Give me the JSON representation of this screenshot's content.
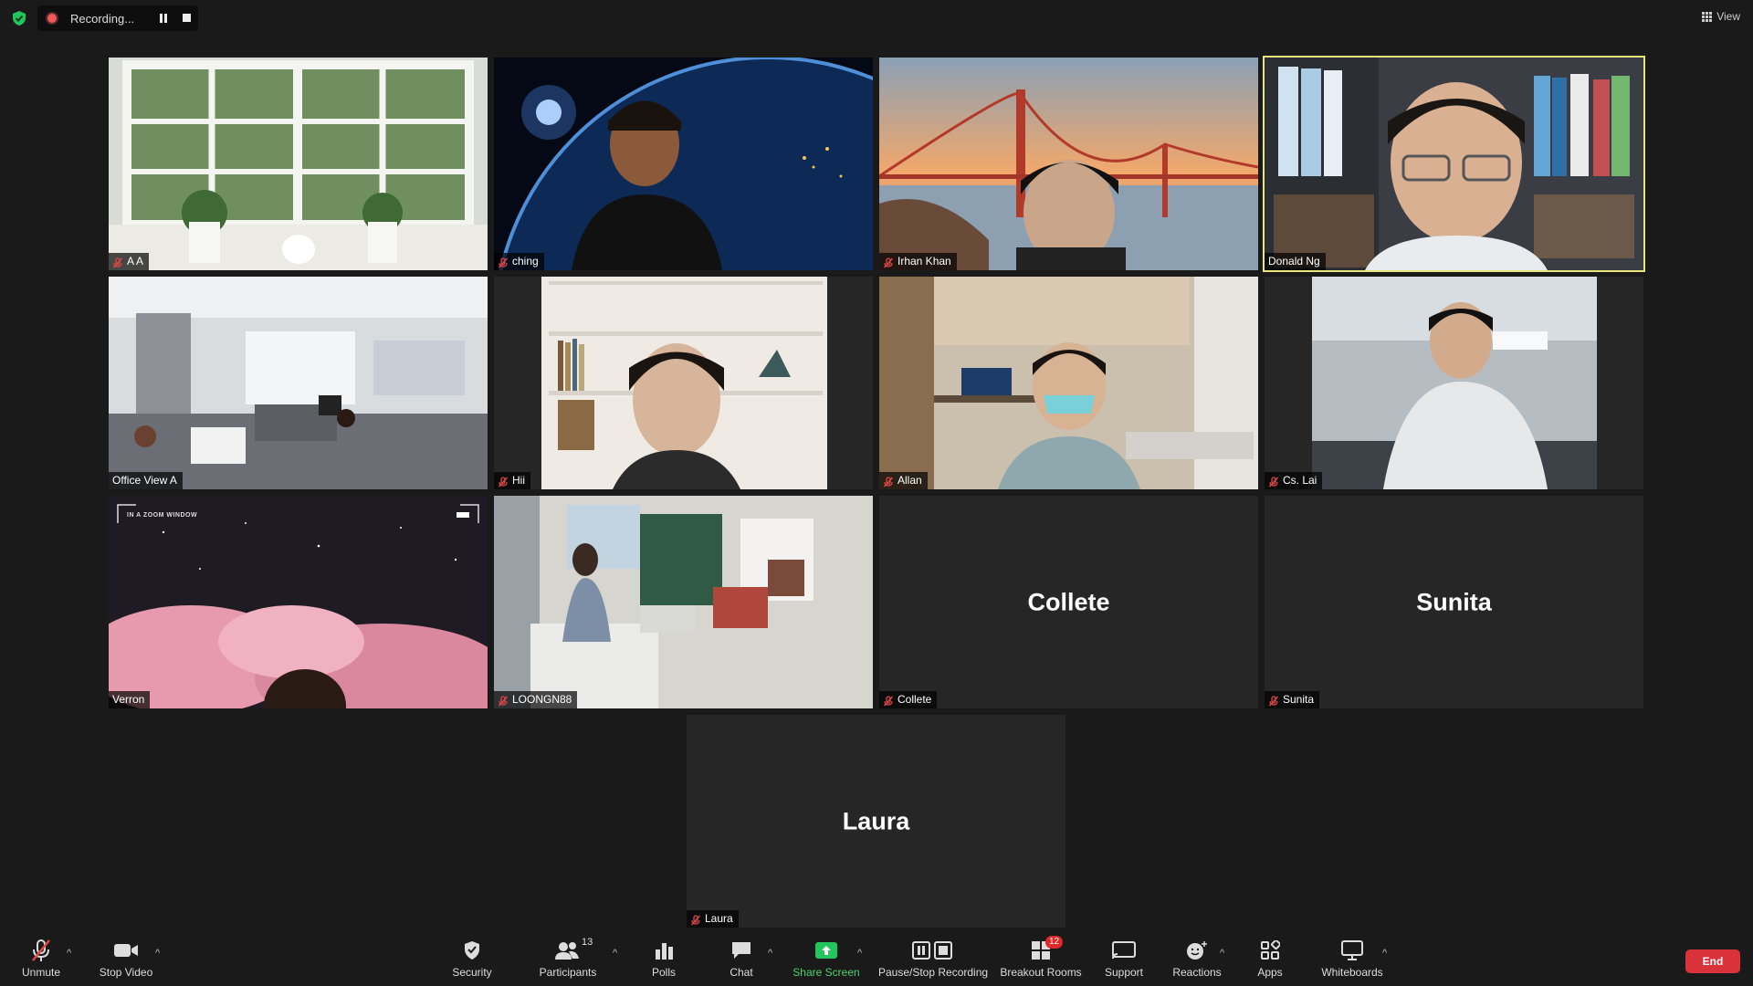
{
  "recording": {
    "status": "Recording..."
  },
  "view": {
    "label": "View"
  },
  "tiles": [
    {
      "name": "A A",
      "muted": true,
      "video": "window"
    },
    {
      "name": "ching",
      "muted": true,
      "video": "earth"
    },
    {
      "name": "Irhan Khan",
      "muted": true,
      "video": "bridge"
    },
    {
      "name": "Donald Ng",
      "muted": false,
      "video": "library",
      "active": true
    },
    {
      "name": "Office View A",
      "muted": false,
      "video": "office"
    },
    {
      "name": "Hii",
      "muted": true,
      "video": "shelves"
    },
    {
      "name": "Allan",
      "muted": true,
      "video": "studio"
    },
    {
      "name": "Cs. Lai",
      "muted": true,
      "video": "desk"
    },
    {
      "name": "Verron",
      "muted": false,
      "video": "clouds",
      "overlay_text": "IN A ZOOM WINDOW"
    },
    {
      "name": "LOONGN88",
      "muted": true,
      "video": "room"
    },
    {
      "name": "Collete",
      "muted": true,
      "video": "none",
      "display_name": "Collete"
    },
    {
      "name": "Sunita",
      "muted": true,
      "video": "none",
      "display_name": "Sunita"
    },
    {
      "name": "Laura",
      "muted": true,
      "video": "none",
      "display_name": "Laura"
    }
  ],
  "toolbar": {
    "unmute": "Unmute",
    "stop_video": "Stop Video",
    "security": "Security",
    "participants": "Participants",
    "participant_count": "13",
    "polls": "Polls",
    "chat": "Chat",
    "share_screen": "Share Screen",
    "pause_stop_recording": "Pause/Stop Recording",
    "breakout_rooms": "Breakout Rooms",
    "breakout_count": "12",
    "support": "Support",
    "reactions": "Reactions",
    "apps": "Apps",
    "whiteboards": "Whiteboards",
    "end": "End"
  },
  "colors": {
    "background": "#1a1a1a",
    "tile": "#262626",
    "active_speaker": "#e6e67a",
    "end_button": "#d9323a",
    "share_green": "#4ed46a",
    "mute_red": "#e04848"
  }
}
